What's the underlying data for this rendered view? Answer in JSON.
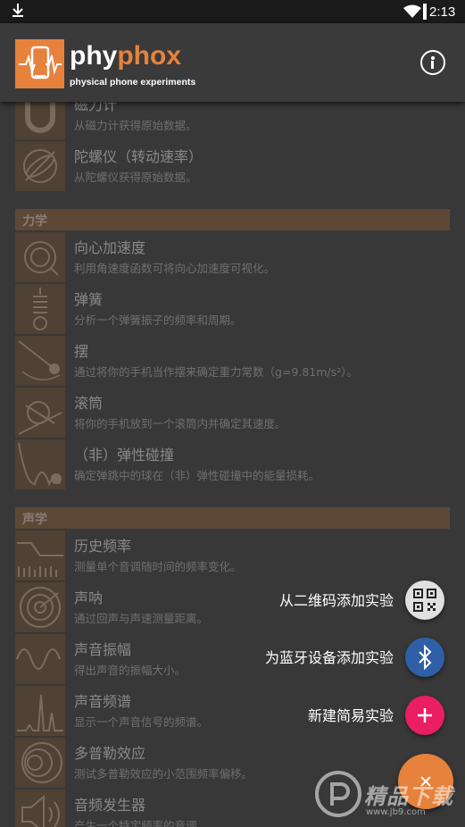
{
  "status_bar": {
    "time": "2:13"
  },
  "app_bar": {
    "brand_phy": "phy",
    "brand_phox": "phox",
    "tagline": "physical phone experiments"
  },
  "list": {
    "top_items": [
      {
        "title": "磁力计",
        "desc": "从磁力计获得原始数据。",
        "icon": "magnet-icon"
      },
      {
        "title": "陀螺仪（转动速率）",
        "desc": "从陀螺仪获得原始数据。",
        "icon": "gyroscope-icon"
      }
    ],
    "categories": [
      {
        "name": "力学",
        "items": [
          {
            "title": "向心加速度",
            "desc": "利用角速度函数可将向心加速度可视化。",
            "icon": "centripetal-icon"
          },
          {
            "title": "弹簧",
            "desc": "分析一个弹簧振子的频率和周期。",
            "icon": "spring-icon"
          },
          {
            "title": "摆",
            "desc": "通过将你的手机当作摆来确定重力常数（g=9.81m/s²）。",
            "icon": "pendulum-icon"
          },
          {
            "title": "滚筒",
            "desc": "将你的手机放到一个滚筒内并确定其速度。",
            "icon": "roll-icon"
          },
          {
            "title": "（非）弹性碰撞",
            "desc": "确定弹跳中的球在（非）弹性碰撞中的能量损耗。",
            "icon": "bounce-icon"
          }
        ]
      },
      {
        "name": "声学",
        "items": [
          {
            "title": "历史频率",
            "desc": "测量单个音调随时间的频率变化。",
            "icon": "frequency-history-icon"
          },
          {
            "title": "声呐",
            "desc": "通过回声与声速测量距离。",
            "icon": "sonar-icon"
          },
          {
            "title": "声音振幅",
            "desc": "得出声音的振幅大小。",
            "icon": "amplitude-icon"
          },
          {
            "title": "声音频谱",
            "desc": "显示一个声音信号的频谱。",
            "icon": "spectrum-icon"
          },
          {
            "title": "多普勒效应",
            "desc": "测试多普勒效应的小范围频率偏移。",
            "icon": "doppler-icon"
          },
          {
            "title": "音频发生器",
            "desc": "产生一个特定频率的音调。",
            "icon": "tone-generator-icon"
          }
        ]
      }
    ]
  },
  "fab_menu": {
    "qr_label": "从二维码添加实验",
    "bluetooth_label": "为蓝牙设备添加实验",
    "simple_label": "新建简易实验"
  },
  "watermark": {
    "text": "精品下载",
    "sub": "www.jb9.com"
  },
  "colors": {
    "accent": "#e6823c",
    "bluetooth": "#2f5fa6",
    "pink": "#e91e63",
    "category_bar": "#6a5240"
  }
}
